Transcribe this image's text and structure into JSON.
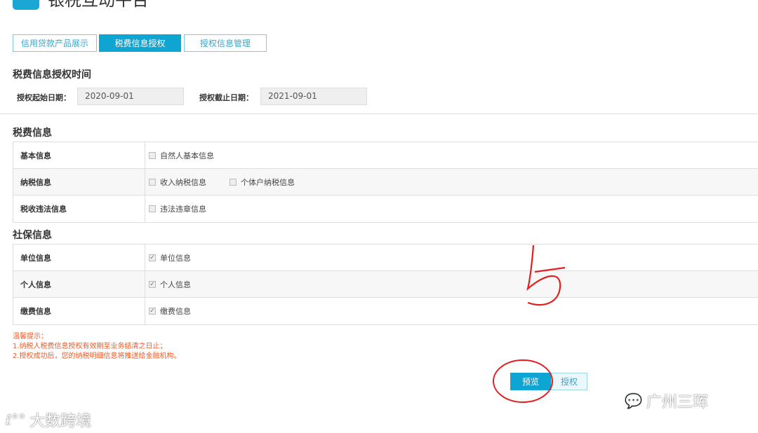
{
  "header": {
    "title": "银税互动平台"
  },
  "tabs": [
    {
      "label": "信用贷款产品展示",
      "active": false
    },
    {
      "label": "税费信息授权",
      "active": true
    },
    {
      "label": "授权信息管理",
      "active": false
    }
  ],
  "auth_time": {
    "heading": "税费信息授权时间",
    "start_label": "授权起始日期：",
    "start_value": "2020-09-01",
    "end_label": "授权截止日期：",
    "end_value": "2021-09-01"
  },
  "tax_info": {
    "heading": "税费信息",
    "rows": [
      {
        "label": "基本信息",
        "options": [
          {
            "label": "自然人基本信息",
            "checked": false
          }
        ]
      },
      {
        "label": "纳税信息",
        "options": [
          {
            "label": "收入纳税信息",
            "checked": false
          },
          {
            "label": "个体户纳税信息",
            "checked": false
          }
        ]
      },
      {
        "label": "税收违法信息",
        "options": [
          {
            "label": "违法违章信息",
            "checked": false
          }
        ]
      }
    ]
  },
  "social_info": {
    "heading": "社保信息",
    "rows": [
      {
        "label": "单位信息",
        "options": [
          {
            "label": "单位信息",
            "checked": true
          }
        ]
      },
      {
        "label": "个人信息",
        "options": [
          {
            "label": "个人信息",
            "checked": true
          }
        ]
      },
      {
        "label": "缴费信息",
        "options": [
          {
            "label": "缴费信息",
            "checked": true
          }
        ]
      }
    ]
  },
  "tips": {
    "title": "温馨提示：",
    "lines": [
      "1.纳税人税费信息授权有效期至业务结清之日止；",
      "2.授权成功后，您的纳税明细信息将推送给金融机构。"
    ]
  },
  "buttons": {
    "preview": "预览",
    "authorize": "授权"
  },
  "watermarks": {
    "left": "大数跨境",
    "right": "广州三珲"
  },
  "colors": {
    "accent": "#0ea5d2",
    "tips": "#f05a28",
    "annotation": "#e02020"
  }
}
